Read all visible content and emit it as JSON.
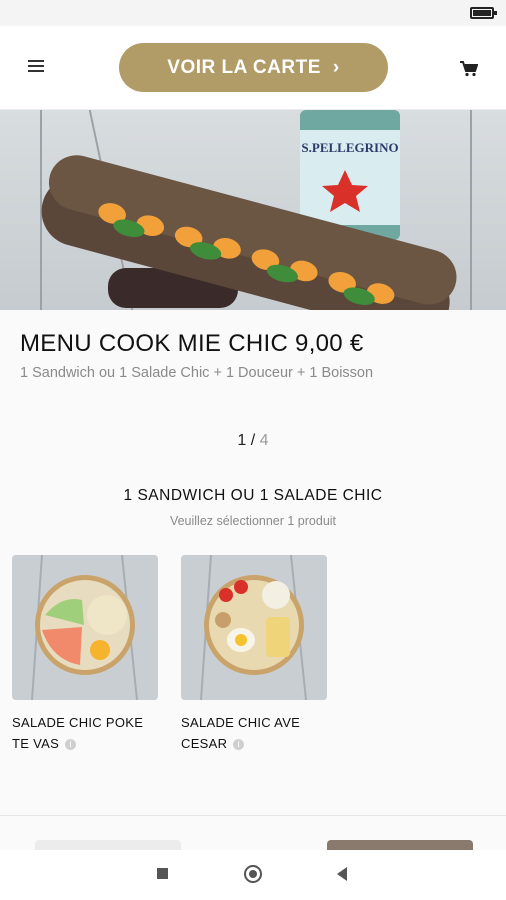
{
  "header": {
    "cta_label": "VOIR LA CARTE",
    "cta_arrow": "›",
    "menu_icon": "hamburger-menu-icon",
    "cart_icon": "shopping-cart-icon",
    "accent_color": "#b19b67"
  },
  "hero": {
    "image": "baguette-sandwich-with-sparkling-water-photo",
    "bottle_label": "S.PELLEGRINO"
  },
  "product": {
    "title": "MENU COOK MIE CHIC 9,00 €",
    "subtitle": "1 Sandwich ou 1 Salade Chic + 1 Douceur + 1 Boisson"
  },
  "pager": {
    "current": "1",
    "separator": " / ",
    "total": "4"
  },
  "section": {
    "title": "1 SANDWICH OU 1 SALADE CHIC",
    "hint": "Veuillez sélectionner 1 produit"
  },
  "products": [
    {
      "name": "SALADE CHIC POKE TE VAS",
      "image": "poke-bowl-salmon-photo",
      "info_icon": "info-icon"
    },
    {
      "name": "SALADE CHIC AVE CESAR",
      "image": "caesar-salad-bowl-photo",
      "info_icon": "info-icon"
    }
  ],
  "system_nav": {
    "recents_icon": "recents-square-icon",
    "home_icon": "home-circle-icon",
    "back_icon": "back-triangle-icon"
  }
}
